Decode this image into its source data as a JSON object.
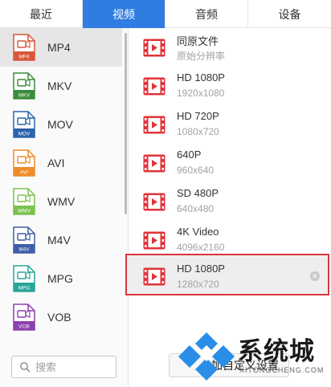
{
  "tabs": [
    {
      "label": "最近",
      "active": false
    },
    {
      "label": "视频",
      "active": true
    },
    {
      "label": "音频",
      "active": false
    },
    {
      "label": "设备",
      "active": false
    }
  ],
  "formats": [
    {
      "label": "MP4",
      "badge": "MP4",
      "color": "#d9573a",
      "selected": true
    },
    {
      "label": "MKV",
      "badge": "MKV",
      "color": "#3d8c3d",
      "selected": false
    },
    {
      "label": "MOV",
      "badge": "MOV",
      "color": "#2b63ae",
      "selected": false
    },
    {
      "label": "AVI",
      "badge": "AVI",
      "color": "#ee8c2a",
      "selected": false
    },
    {
      "label": "WMV",
      "badge": "WMV",
      "color": "#7bc24e",
      "selected": false
    },
    {
      "label": "M4V",
      "badge": "M4V",
      "color": "#3e5ea8",
      "selected": false
    },
    {
      "label": "MPG",
      "badge": "MPG",
      "color": "#29a59a",
      "selected": false
    },
    {
      "label": "VOB",
      "badge": "VOB",
      "color": "#8c3fae",
      "selected": false
    }
  ],
  "search": {
    "placeholder": "搜索",
    "icon": "search-icon"
  },
  "presets": [
    {
      "title": "同原文件",
      "subtitle": "原始分辨率",
      "highlighted": false
    },
    {
      "title": "HD 1080P",
      "subtitle": "1920x1080",
      "highlighted": false
    },
    {
      "title": "HD 720P",
      "subtitle": "1080x720",
      "highlighted": false
    },
    {
      "title": "640P",
      "subtitle": "960x640",
      "highlighted": false
    },
    {
      "title": "SD 480P",
      "subtitle": "640x480",
      "highlighted": false
    },
    {
      "title": "4K Video",
      "subtitle": "4096x2160",
      "highlighted": false
    },
    {
      "title": "HD 1080P",
      "subtitle": "1280x720",
      "highlighted": true
    }
  ],
  "custom_button": {
    "label": "加自定义设置"
  },
  "watermark": {
    "text": "系统城",
    "sub": "XITONGCHENG.COM"
  },
  "colors": {
    "accent": "#2f7de1",
    "highlight_border": "#d9363e",
    "film_icon": "#e0343a"
  }
}
